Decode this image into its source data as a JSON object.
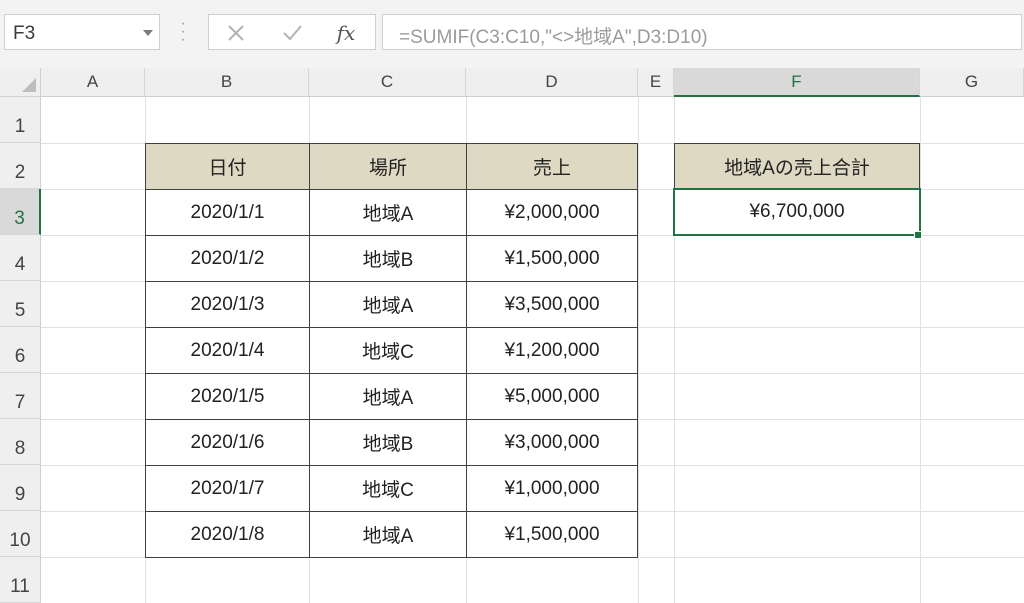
{
  "formula_bar": {
    "name_box": "F3",
    "formula": "=SUMIF(C3:C10,\"<>地域A\",D3:D10)",
    "fx_label": "fx"
  },
  "columns": [
    "A",
    "B",
    "C",
    "D",
    "E",
    "F",
    "G"
  ],
  "rows": [
    "1",
    "2",
    "3",
    "4",
    "5",
    "6",
    "7",
    "8",
    "9",
    "10",
    "11"
  ],
  "table": {
    "headers": [
      "日付",
      "場所",
      "売上"
    ],
    "rows": [
      [
        "2020/1/1",
        "地域A",
        "¥2,000,000"
      ],
      [
        "2020/1/2",
        "地域B",
        "¥1,500,000"
      ],
      [
        "2020/1/3",
        "地域A",
        "¥3,500,000"
      ],
      [
        "2020/1/4",
        "地域C",
        "¥1,200,000"
      ],
      [
        "2020/1/5",
        "地域A",
        "¥5,000,000"
      ],
      [
        "2020/1/6",
        "地域B",
        "¥3,000,000"
      ],
      [
        "2020/1/7",
        "地域C",
        "¥1,000,000"
      ],
      [
        "2020/1/8",
        "地域A",
        "¥1,500,000"
      ]
    ]
  },
  "summary": {
    "header": "地域Aの売上合計",
    "value": "¥6,700,000"
  },
  "selection": {
    "cell": "F3",
    "column": "F",
    "row": "3"
  },
  "colors": {
    "header_fill": "#ddd9c3",
    "selection_accent": "#217346"
  }
}
